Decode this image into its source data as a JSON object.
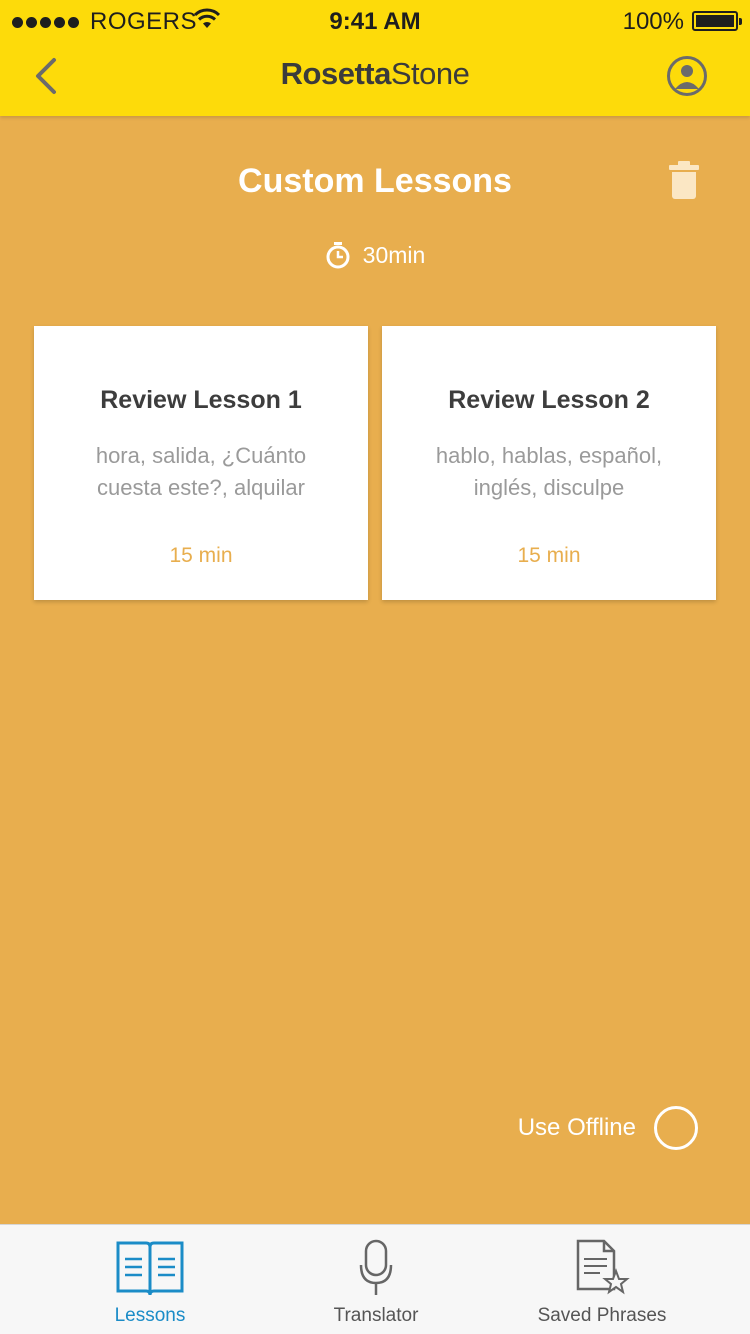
{
  "status_bar": {
    "carrier": "ROGERS",
    "time": "9:41 AM",
    "battery": "100%"
  },
  "nav": {
    "brand_part1": "Rosetta",
    "brand_part2": "Stone"
  },
  "header": {
    "title": "Custom Lessons",
    "duration": "30min"
  },
  "lessons": [
    {
      "title": "Review Lesson 1",
      "words": "hora, salida, ¿Cuánto cuesta este?, alquilar",
      "duration": "15 min"
    },
    {
      "title": "Review Lesson 2",
      "words": "hablo, hablas, español, inglés, disculpe",
      "duration": "15 min"
    }
  ],
  "offline": {
    "label": "Use Offline"
  },
  "tabs": [
    {
      "label": "Lessons",
      "icon": "book-icon"
    },
    {
      "label": "Translator",
      "icon": "microphone-icon"
    },
    {
      "label": "Saved Phrases",
      "icon": "saved-document-star-icon"
    }
  ],
  "colors": {
    "topbar": "#FDDB0A",
    "background": "#E8AE4E",
    "active_tab": "#1b8cc7"
  }
}
